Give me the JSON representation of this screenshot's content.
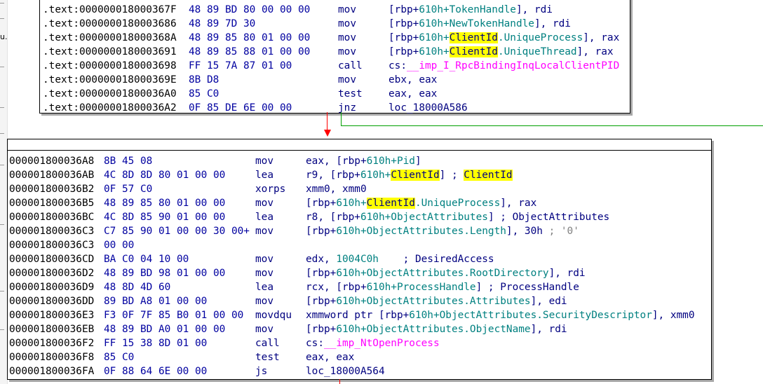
{
  "block1": {
    "lines": [
      {
        "addr": ".text:000000018000367F",
        "bytes": "48 89 BD 80 00 00 00",
        "mnem": "mov",
        "ops": [
          {
            "t": "n",
            "s": "["
          },
          {
            "t": "n",
            "s": "rbp+"
          },
          {
            "t": "v",
            "s": "610h+TokenHandle"
          },
          {
            "t": "n",
            "s": "], rdi"
          }
        ]
      },
      {
        "addr": ".text:0000000180003686",
        "bytes": "48 89 7D 30",
        "mnem": "mov",
        "ops": [
          {
            "t": "n",
            "s": "["
          },
          {
            "t": "n",
            "s": "rbp+"
          },
          {
            "t": "v",
            "s": "610h+NewTokenHandle"
          },
          {
            "t": "n",
            "s": "], rdi"
          }
        ]
      },
      {
        "addr": ".text:000000018000368A",
        "bytes": "48 89 85 80 01 00 00",
        "mnem": "mov",
        "ops": [
          {
            "t": "n",
            "s": "["
          },
          {
            "t": "n",
            "s": "rbp+"
          },
          {
            "t": "v",
            "s": "610h+"
          },
          {
            "t": "h",
            "s": "ClientId"
          },
          {
            "t": "v",
            "s": ".UniqueProcess"
          },
          {
            "t": "n",
            "s": "], rax"
          }
        ]
      },
      {
        "addr": ".text:0000000180003691",
        "bytes": "48 89 85 88 01 00 00",
        "mnem": "mov",
        "ops": [
          {
            "t": "n",
            "s": "["
          },
          {
            "t": "n",
            "s": "rbp+"
          },
          {
            "t": "v",
            "s": "610h+"
          },
          {
            "t": "h",
            "s": "ClientId"
          },
          {
            "t": "v",
            "s": ".UniqueThread"
          },
          {
            "t": "n",
            "s": "], rax"
          }
        ]
      },
      {
        "addr": ".text:0000000180003698",
        "bytes": "FF 15 7A 87 01 00",
        "mnem": "call",
        "ops": [
          {
            "t": "n",
            "s": "cs:"
          },
          {
            "t": "i",
            "s": "__imp_I_RpcBindingInqLocalClientPID"
          }
        ]
      },
      {
        "addr": ".text:000000018000369E",
        "bytes": "8B D8",
        "mnem": "mov",
        "ops": [
          {
            "t": "n",
            "s": "ebx, eax"
          }
        ]
      },
      {
        "addr": ".text:00000001800036A0",
        "bytes": "85 C0",
        "mnem": "test",
        "ops": [
          {
            "t": "n",
            "s": "eax, eax"
          }
        ]
      },
      {
        "addr": ".text:00000001800036A2",
        "bytes": "0F 85 DE 6E 00 00",
        "mnem": "jnz",
        "ops": [
          {
            "t": "n",
            "s": "loc_18000A586"
          }
        ]
      }
    ]
  },
  "block2": {
    "lines": [
      {
        "addr": "000001800036A8",
        "bytes": "8B 45 08",
        "mnem": "mov",
        "ops": [
          {
            "t": "n",
            "s": "eax, [rbp+"
          },
          {
            "t": "v",
            "s": "610h+Pid"
          },
          {
            "t": "n",
            "s": "]"
          }
        ]
      },
      {
        "addr": "000001800036AB",
        "bytes": "4C 8D 8D 80 01 00 00",
        "mnem": "lea",
        "ops": [
          {
            "t": "n",
            "s": "r9, [rbp+"
          },
          {
            "t": "v",
            "s": "610h+"
          },
          {
            "t": "h",
            "s": "ClientId"
          },
          {
            "t": "n",
            "s": "] ; "
          },
          {
            "t": "h",
            "s": "ClientId"
          }
        ]
      },
      {
        "addr": "000001800036B2",
        "bytes": "0F 57 C0",
        "mnem": "xorps",
        "ops": [
          {
            "t": "n",
            "s": "xmm0, xmm0"
          }
        ]
      },
      {
        "addr": "000001800036B5",
        "bytes": "48 89 85 80 01 00 00",
        "mnem": "mov",
        "ops": [
          {
            "t": "n",
            "s": "[rbp+"
          },
          {
            "t": "v",
            "s": "610h+"
          },
          {
            "t": "h",
            "s": "ClientId"
          },
          {
            "t": "v",
            "s": ".UniqueProcess"
          },
          {
            "t": "n",
            "s": "], rax"
          }
        ]
      },
      {
        "addr": "000001800036BC",
        "bytes": "4C 8D 85 90 01 00 00",
        "mnem": "lea",
        "ops": [
          {
            "t": "n",
            "s": "r8, [rbp+"
          },
          {
            "t": "v",
            "s": "610h+ObjectAttributes"
          },
          {
            "t": "n",
            "s": "] ; ObjectAttributes"
          }
        ]
      },
      {
        "addr": "000001800036C3",
        "bytes": "C7 85 90 01 00 00 30 00+",
        "mnem": "mov",
        "ops": [
          {
            "t": "n",
            "s": "[rbp+"
          },
          {
            "t": "v",
            "s": "610h+ObjectAttributes.Length"
          },
          {
            "t": "n",
            "s": "], 30h"
          },
          {
            "t": "g",
            "s": " ; '0'"
          }
        ]
      },
      {
        "addr": "000001800036C3",
        "bytes": "00 00",
        "mnem": "",
        "ops": []
      },
      {
        "addr": "000001800036CD",
        "bytes": "BA C0 04 10 00",
        "mnem": "mov",
        "ops": [
          {
            "t": "n",
            "s": "edx, "
          },
          {
            "t": "v",
            "s": "1004C0h"
          },
          {
            "t": "n",
            "s": "    ; DesiredAccess"
          }
        ]
      },
      {
        "addr": "000001800036D2",
        "bytes": "48 89 BD 98 01 00 00",
        "mnem": "mov",
        "ops": [
          {
            "t": "n",
            "s": "[rbp+"
          },
          {
            "t": "v",
            "s": "610h+ObjectAttributes.RootDirectory"
          },
          {
            "t": "n",
            "s": "], rdi"
          }
        ]
      },
      {
        "addr": "000001800036D9",
        "bytes": "48 8D 4D 60",
        "mnem": "lea",
        "ops": [
          {
            "t": "n",
            "s": "rcx, [rbp+"
          },
          {
            "t": "v",
            "s": "610h+ProcessHandle"
          },
          {
            "t": "n",
            "s": "] ; ProcessHandle"
          }
        ]
      },
      {
        "addr": "000001800036DD",
        "bytes": "89 BD A8 01 00 00",
        "mnem": "mov",
        "ops": [
          {
            "t": "n",
            "s": "[rbp+"
          },
          {
            "t": "v",
            "s": "610h+ObjectAttributes.Attributes"
          },
          {
            "t": "n",
            "s": "], edi"
          }
        ]
      },
      {
        "addr": "000001800036E3",
        "bytes": "F3 0F 7F 85 B0 01 00 00",
        "mnem": "movdqu",
        "ops": [
          {
            "t": "n",
            "s": "xmmword ptr [rbp+"
          },
          {
            "t": "v",
            "s": "610h+ObjectAttributes.SecurityDescriptor"
          },
          {
            "t": "n",
            "s": "], xmm0"
          }
        ]
      },
      {
        "addr": "000001800036EB",
        "bytes": "48 89 BD A0 01 00 00",
        "mnem": "mov",
        "ops": [
          {
            "t": "n",
            "s": "[rbp+"
          },
          {
            "t": "v",
            "s": "610h+ObjectAttributes.ObjectName"
          },
          {
            "t": "n",
            "s": "], rdi"
          }
        ]
      },
      {
        "addr": "000001800036F2",
        "bytes": "FF 15 38 8D 01 00",
        "mnem": "call",
        "ops": [
          {
            "t": "n",
            "s": "cs:"
          },
          {
            "t": "i",
            "s": "__imp_NtOpenProcess"
          }
        ]
      },
      {
        "addr": "000001800036F8",
        "bytes": "85 C0",
        "mnem": "test",
        "ops": [
          {
            "t": "n",
            "s": "eax, eax"
          }
        ]
      },
      {
        "addr": "000001800036FA",
        "bytes": "0F 88 64 6E 00 00",
        "mnem": "js",
        "ops": [
          {
            "t": "n",
            "s": "loc_18000A564"
          }
        ]
      }
    ]
  },
  "margin": {
    "glyph": "u."
  },
  "colors": {
    "true_edge": "#00a000",
    "false_edge": "#ff0000",
    "highlight": "#ffff00",
    "import": "#ff00ff"
  }
}
